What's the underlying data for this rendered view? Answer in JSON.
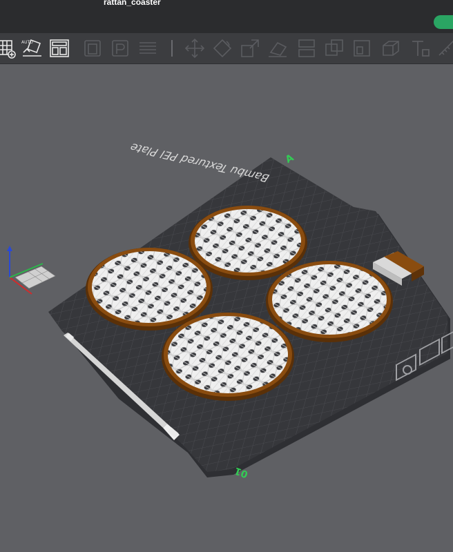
{
  "window": {
    "title": "rattan_coaster"
  },
  "toolbar": {
    "tools": [
      {
        "icon": "add-plate-icon",
        "enabled": true
      },
      {
        "icon": "auto-orient-icon",
        "label": "AUTO",
        "enabled": true
      },
      {
        "icon": "arrange-icon",
        "enabled": true
      },
      {
        "icon": "orient-icon",
        "enabled": false
      },
      {
        "icon": "arrange-plates-icon",
        "enabled": false
      },
      {
        "icon": "layers-icon",
        "enabled": false
      },
      {
        "icon": "move-icon",
        "enabled": false
      },
      {
        "icon": "rotate-icon",
        "enabled": false
      },
      {
        "icon": "scale-icon",
        "enabled": false
      },
      {
        "icon": "lay-on-face-icon",
        "enabled": false
      },
      {
        "icon": "cut-icon",
        "enabled": false
      },
      {
        "icon": "support-paint-icon",
        "enabled": false
      },
      {
        "icon": "seam-paint-icon",
        "enabled": false
      },
      {
        "icon": "assembly-icon",
        "enabled": false
      },
      {
        "icon": "text-icon",
        "enabled": false
      },
      {
        "icon": "measure-icon",
        "enabled": false
      }
    ]
  },
  "viewport": {
    "plate_label": "Bambu Textured PEI Plate",
    "plate_number": "01",
    "origin_marker": "A",
    "object": "rattan coaster",
    "object_count": 4,
    "colors": {
      "plate": "#36373b",
      "grid": "#4a4b50",
      "rim": "#8a4c0f",
      "weave": "#f2f2f2",
      "axis_x": "#d42a2a",
      "axis_y": "#2bb84a",
      "axis_z": "#2a49d6",
      "accent_green": "#2aa563"
    }
  }
}
